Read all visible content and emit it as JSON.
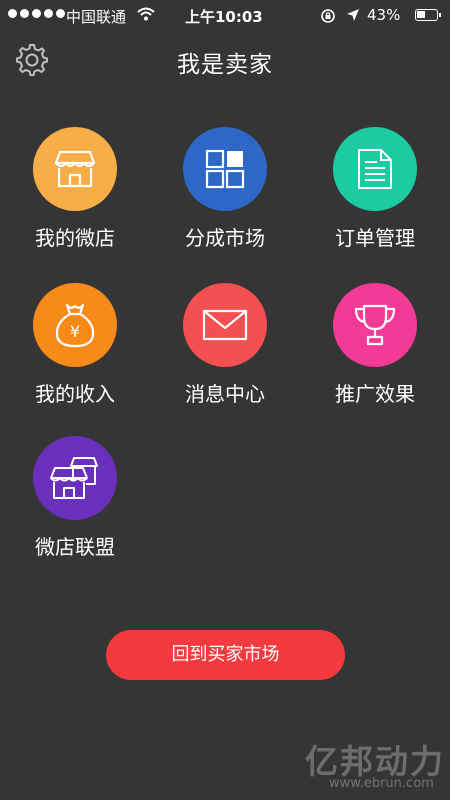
{
  "status_bar": {
    "carrier": "中国联通",
    "time": "上午10:03",
    "battery": "43%"
  },
  "nav": {
    "title": "我是卖家",
    "settings_icon": "gear-icon"
  },
  "tiles": [
    {
      "label": "我的微店",
      "icon": "shop-icon",
      "color": "#f7ae46"
    },
    {
      "label": "分成市场",
      "icon": "grid-icon",
      "color": "#2d68c7"
    },
    {
      "label": "订单管理",
      "icon": "document-icon",
      "color": "#1ccba1"
    },
    {
      "label": "我的收入",
      "icon": "money-bag-icon",
      "color": "#f88a1a"
    },
    {
      "label": "消息中心",
      "icon": "envelope-icon",
      "color": "#f44f51"
    },
    {
      "label": "推广效果",
      "icon": "trophy-icon",
      "color": "#f23a96"
    },
    {
      "label": "微店联盟",
      "icon": "shops-icon",
      "color": "#6a2fbd"
    }
  ],
  "back_button": {
    "label": "回到买家市场",
    "color": "#f33a3e"
  },
  "watermark": {
    "logo": "亿邦动力",
    "url": "www.ebrun.com"
  }
}
